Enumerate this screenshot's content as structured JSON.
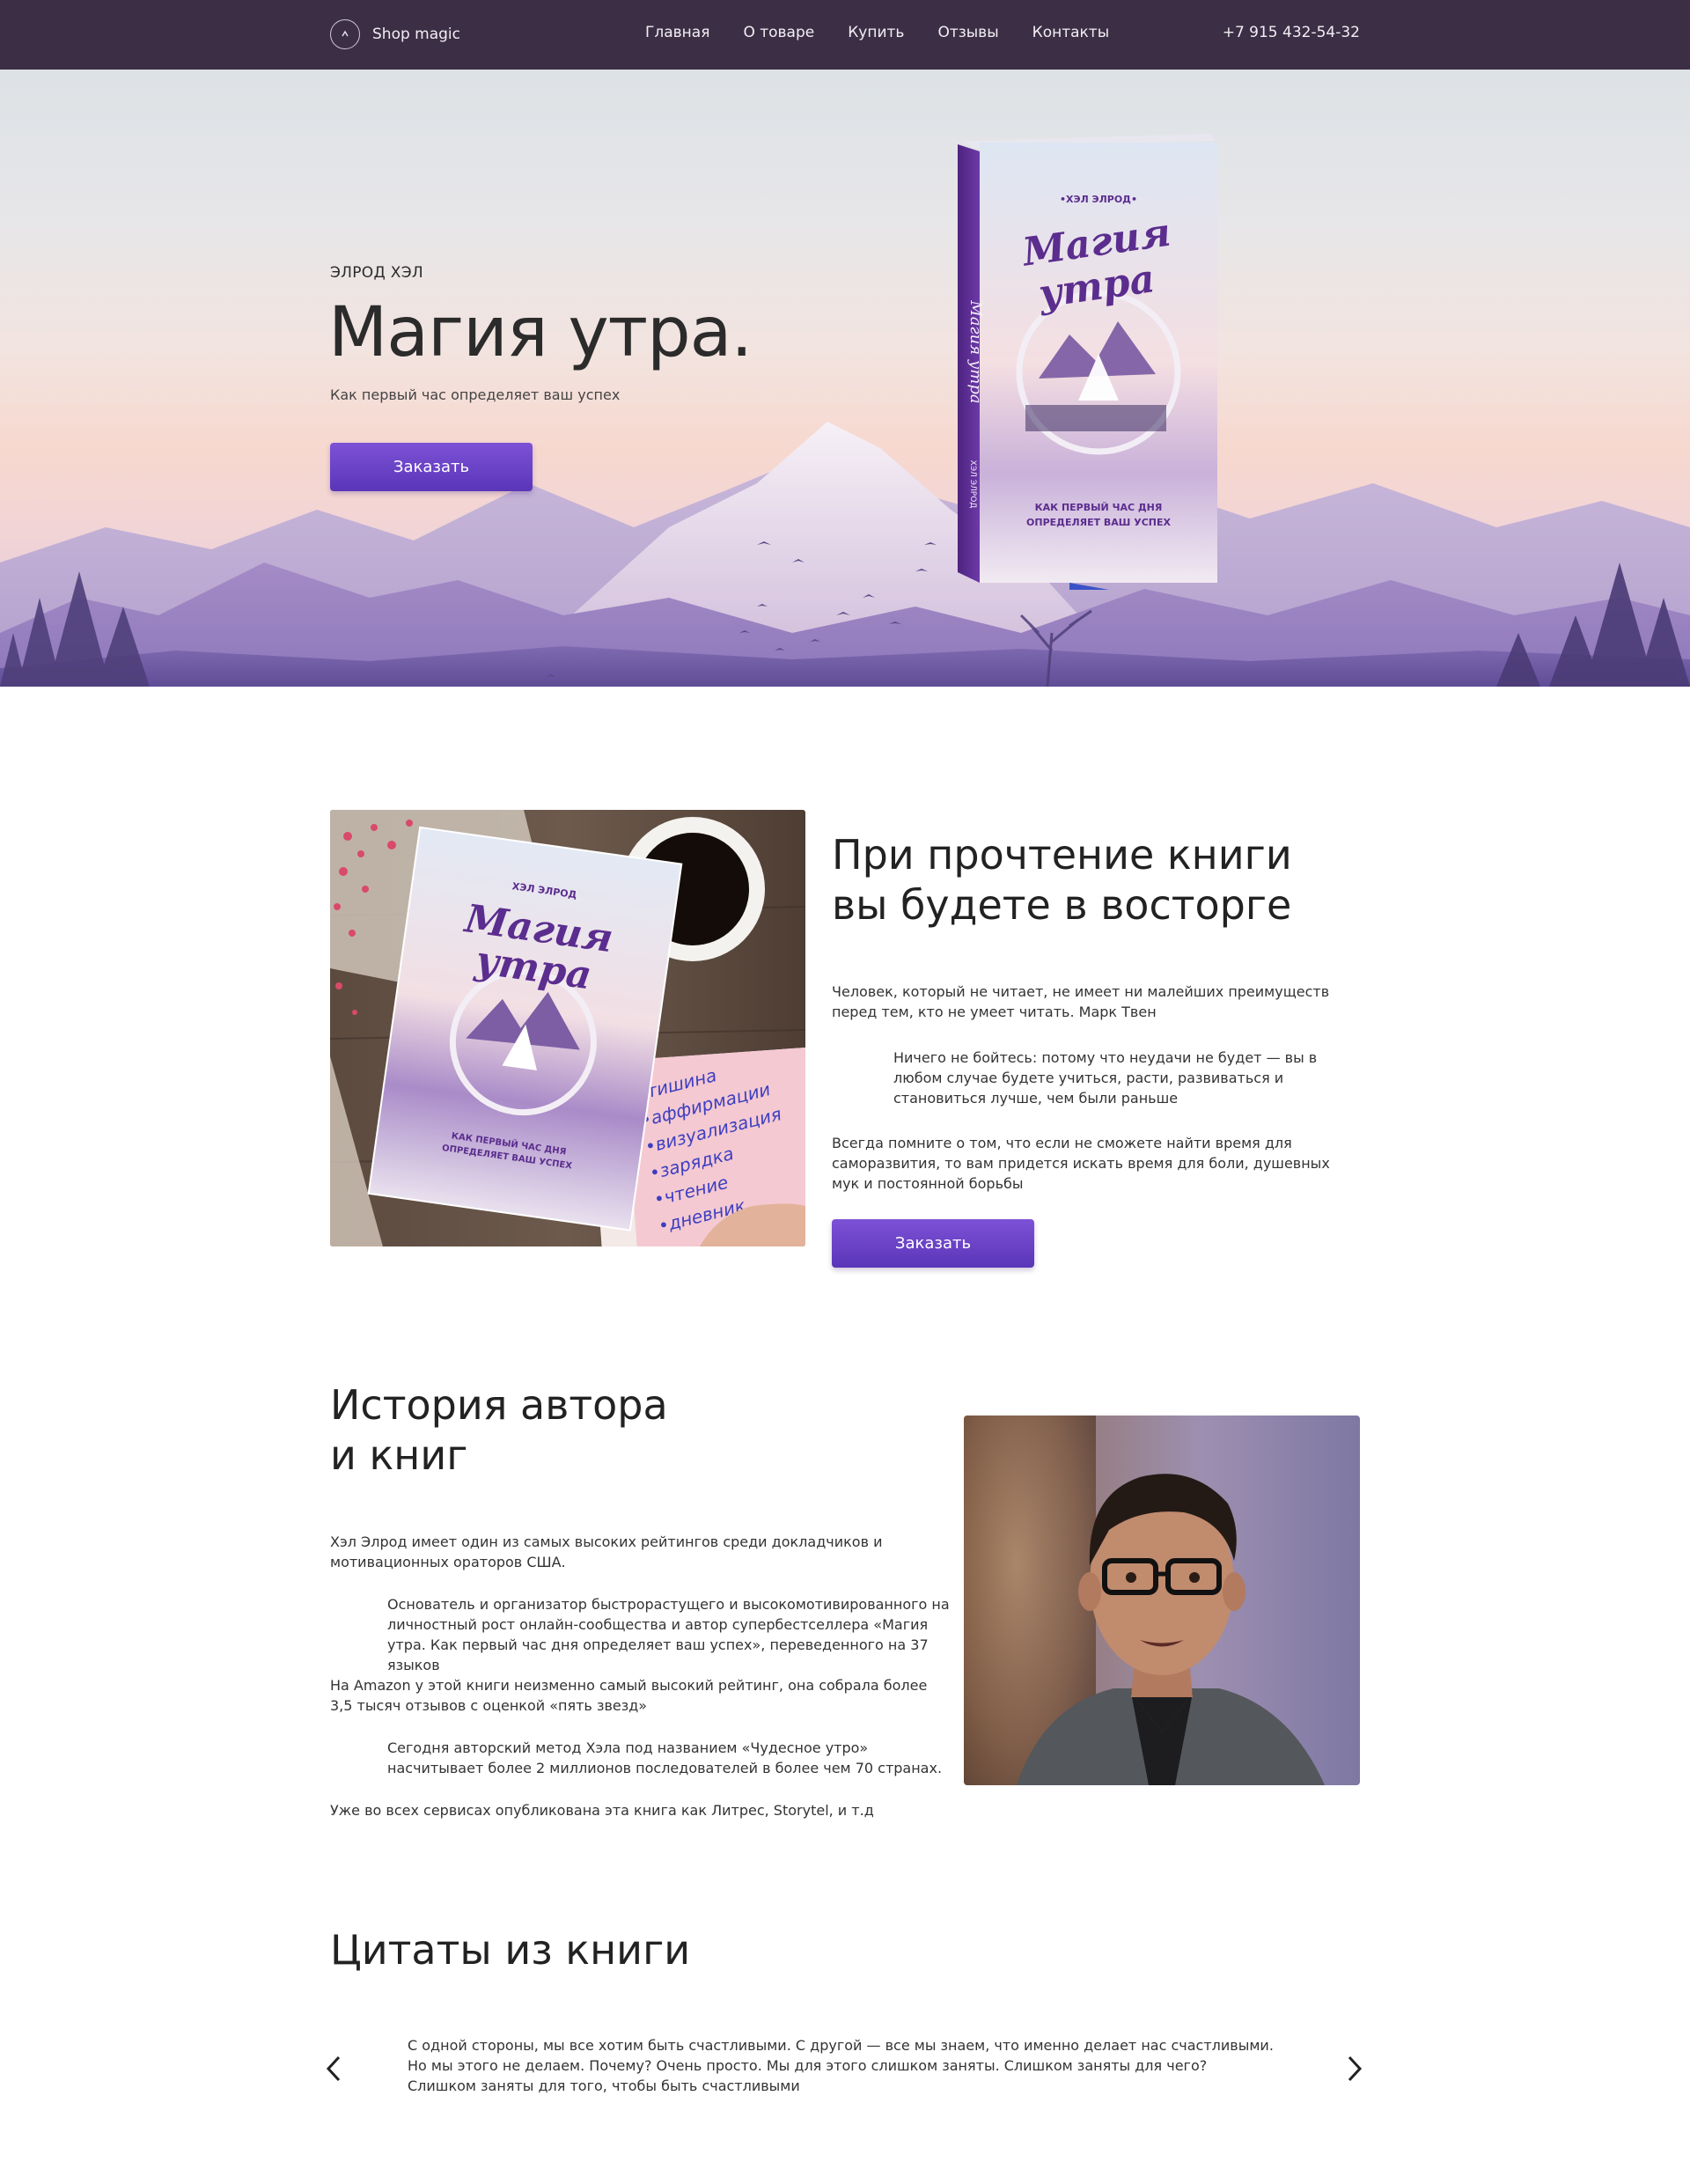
{
  "header": {
    "logo_text": "Shop magic",
    "nav": [
      "Главная",
      "О товаре",
      "Купить",
      "Отзывы",
      "Контакты"
    ],
    "phone": "+7 915 432-54-32"
  },
  "hero": {
    "author": "ЭЛРОД ХЭЛ",
    "title": "Магия утра.",
    "subtitle": "Как первый час определяет ваш успех",
    "order_button": "Заказать",
    "book_cover": {
      "author": "•ХЭЛ ЭЛРОД•",
      "title_line1": "Магия",
      "title_line2": "утра",
      "tagline_line1": "КАК ПЕРВЫЙ ЧАС ДНЯ",
      "tagline_line2": "ОПРЕДЕЛЯЕТ ВАШ УСПЕХ",
      "spine_title": "Магия утра",
      "spine_author": "ХЭЛ ЭЛРОД"
    }
  },
  "about": {
    "title_line1": "При прочтение книги",
    "title_line2": "вы будете в восторге",
    "p1": "Человек, который не читает, не имеет ни малейших преимуществ перед тем, кто не умеет читать. Марк Твен",
    "p2": "Ничего не бойтесь: потому что неудачи не будет — вы в любом случае будете учиться, расти, развиваться и становиться лучше, чем были раньше",
    "p3": "Всегда помните о том, что если не сможете найти время для саморазвития, то вам придется искать время для боли, душевных мук и постоянной борьбы",
    "order_button": "Заказать",
    "photo": {
      "book_author": "ХЭЛ ЭЛРОД",
      "book_title_line1": "Магия",
      "book_title_line2": "утра",
      "book_tagline_line1": "КАК ПЕРВЫЙ ЧАС ДНЯ",
      "book_tagline_line2": "ОПРЕДЕЛЯЕТ ВАШ УСПЕХ",
      "notebook_list": [
        "•тишина",
        "•аффирмации",
        "•визуализация",
        "•зарядка",
        "•чтение",
        "•дневник"
      ]
    }
  },
  "author": {
    "title_line1": "История автора",
    "title_line2": "и книг",
    "p1": "Хэл Элрод имеет один из самых высоких рейтингов среди докладчиков и мотивационных ораторов США.",
    "p2": "Основатель и организатор быстрорастущего и высокомотивированного на личностный рост онлайн-сообщества и автор супербестселлера «Магия утра. Как первый час дня определяет ваш успех», переведенного на 37 языков",
    "p3": "На Amazon у этой книги неизменно самый высокий рейтинг, она собрала более 3,5 тысяч отзывов с оценкой «пять звезд»",
    "p4": "Сегодня авторский метод Хэла под названием «Чудесное утро» насчитывает более 2 миллионов последователей в более чем 70 странах.",
    "p5": "Уже во всех сервисах опубликована эта книга как Литрес, Storytel, и т.д"
  },
  "quotes": {
    "title": "Цитаты из книги",
    "text": "С одной стороны, мы все хотим быть счастливыми. С другой — все мы знаем, что именно делает нас счастливыми. Но мы этого не делаем. Почему? Очень просто. Мы для этого слишком заняты. Слишком заняты для чего? Слишком заняты для того, чтобы быть счастливыми"
  },
  "colors": {
    "header_bg": "#3c2f45",
    "button_top": "#7d52d6",
    "button_bottom": "#5a35b8",
    "accent_purple": "#5b2d8e"
  },
  "icons": {
    "logo": "compass-circle-icon",
    "prev": "chevron-left-icon",
    "next": "chevron-right-icon"
  }
}
